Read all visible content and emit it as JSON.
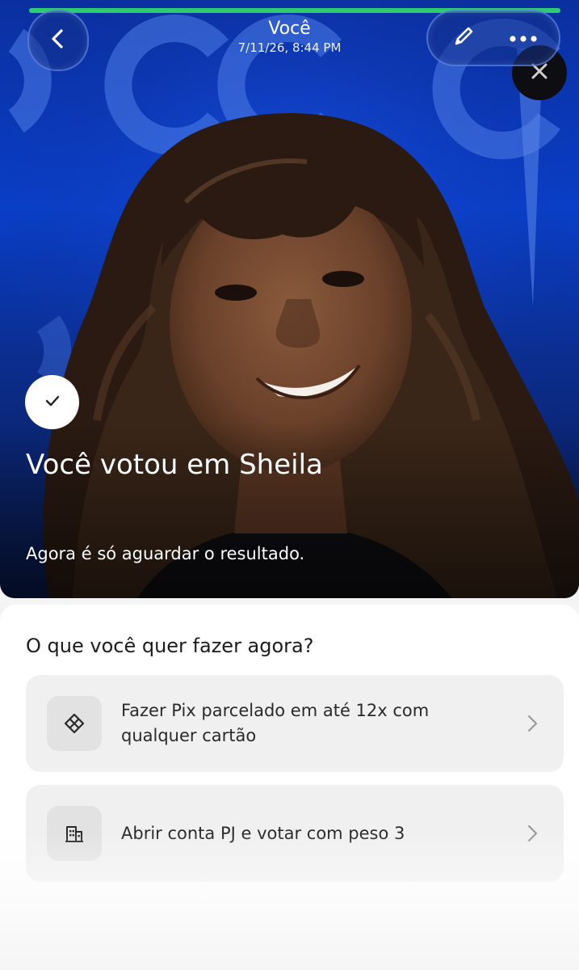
{
  "header": {
    "title": "Você",
    "subtitle": "7/11/26, 8:44 PM",
    "progress": 1.0
  },
  "icons": {
    "back": "chevron-left-icon",
    "edit": "pencil-icon",
    "more": "ellipsis-icon",
    "close": "close-icon",
    "confirm": "checkmark-icon",
    "option1": "pix-icon",
    "option2": "building-icon",
    "chevron": "chevron-right-icon"
  },
  "colors": {
    "hero_blue": "#0a3fc9",
    "hero_dark": "#0a1a4c",
    "progress": "#2ecc71",
    "option_bg": "#f0f0f0"
  },
  "hero": {
    "title": "Você votou em Sheila",
    "subtitle": "Agora é só aguardar o resultado."
  },
  "panel": {
    "title": "O que você quer fazer agora?",
    "options": [
      {
        "label": "Fazer Pix parcelado em até 12x com qualquer cartão"
      },
      {
        "label": "Abrir conta PJ e votar com peso 3"
      }
    ]
  }
}
